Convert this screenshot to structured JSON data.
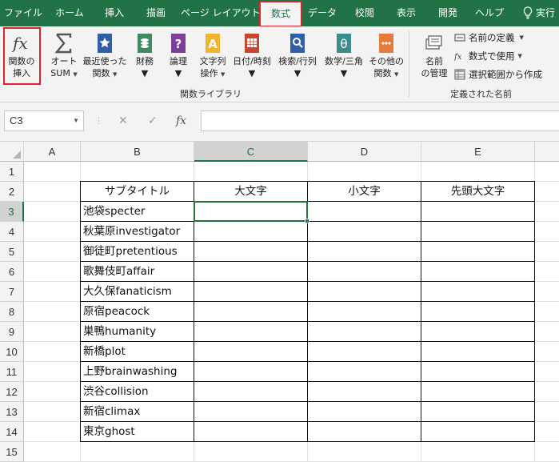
{
  "tabs": [
    "ファイル",
    "ホーム",
    "挿入",
    "描画",
    "ページ レイアウト",
    "数式",
    "データ",
    "校閲",
    "表示",
    "開発",
    "ヘルプ",
    "実行"
  ],
  "active_tab": "数式",
  "ribbon": {
    "insert_function": {
      "line1": "関数の",
      "line2": "挿入"
    },
    "autosum": {
      "line1": "オート",
      "line2": "SUM"
    },
    "recent": {
      "line1": "最近使った",
      "line2": "関数"
    },
    "financial": {
      "line1": "財務"
    },
    "logical": {
      "line1": "論理"
    },
    "text": {
      "line1": "文字列",
      "line2": "操作"
    },
    "datetime": {
      "line1": "日付/時刻"
    },
    "lookup": {
      "line1": "検索/行列"
    },
    "math": {
      "line1": "数学/三角"
    },
    "more": {
      "line1": "その他の",
      "line2": "関数"
    },
    "library_group": "関数ライブラリ",
    "name_manager": {
      "line1": "名前",
      "line2": "の管理"
    },
    "define_name": "名前の定義",
    "use_in_formula": "数式で使用",
    "create_from_selection": "選択範囲から作成",
    "names_group": "定義された名前"
  },
  "formula_bar": {
    "name_box": "C3",
    "fx": "fx",
    "formula": ""
  },
  "columns": [
    "A",
    "B",
    "C",
    "D",
    "E"
  ],
  "selected_column": "C",
  "rows": [
    "1",
    "2",
    "3",
    "4",
    "5",
    "6",
    "7",
    "8",
    "9",
    "10",
    "11",
    "12",
    "13",
    "14",
    "15"
  ],
  "selected_row": "3",
  "table": {
    "headers": [
      "サブタイトル",
      "大文字",
      "小文字",
      "先頭大文字"
    ],
    "subtitles": [
      "池袋specter",
      "秋葉原investigator",
      "御徒町pretentious",
      "歌舞伎町affair",
      "大久保fanaticism",
      "原宿peacock",
      "巣鴨humanity",
      "新橋plot",
      "上野brainwashing",
      "渋谷collision",
      "新宿climax",
      "東京ghost"
    ]
  },
  "colors": {
    "accent": "#217346",
    "highlight": "#e0202a"
  }
}
